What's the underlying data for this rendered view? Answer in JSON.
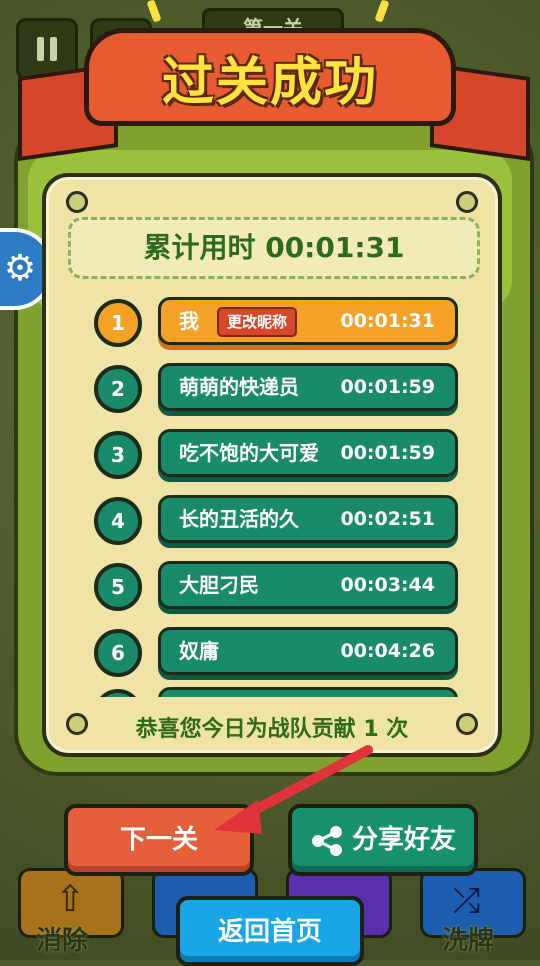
{
  "colors": {
    "ribbon": "#e85a30",
    "ribbon_title": "#ffe23c",
    "card": "#efe3a6",
    "row_green": "#1a8b6a",
    "row_highlight": "#f3a227",
    "next_button": "#e45f3a",
    "share_button": "#17906d",
    "home_button": "#18a6e8",
    "tutorial_arrow": "#e0343a"
  },
  "header": {
    "pause_icon": "pause-icon",
    "level_chip_text": "第一关",
    "title": "过关成功"
  },
  "result": {
    "total_time_label": "累计用时 00:01:31",
    "leaderboard": [
      {
        "rank": "1",
        "name": "我",
        "time": "00:01:31",
        "is_me": true,
        "rename_label": "更改昵称"
      },
      {
        "rank": "2",
        "name": "萌萌的快递员",
        "time": "00:01:59"
      },
      {
        "rank": "3",
        "name": "吃不饱的大可爱",
        "time": "00:01:59"
      },
      {
        "rank": "4",
        "name": "长的丑活的久",
        "time": "00:02:51"
      },
      {
        "rank": "5",
        "name": "大胆刁民",
        "time": "00:03:44"
      },
      {
        "rank": "6",
        "name": "奴庸",
        "time": "00:04:26"
      }
    ],
    "congrats": "恭喜您今日为战队贡献 1 次"
  },
  "actions": {
    "next_label": "下一关",
    "share_label": "分享好友",
    "home_label": "返回首页",
    "share_icon": "share-icon"
  },
  "toolbar": {
    "remove_label": "消除",
    "shuffle_label": "洗牌"
  }
}
